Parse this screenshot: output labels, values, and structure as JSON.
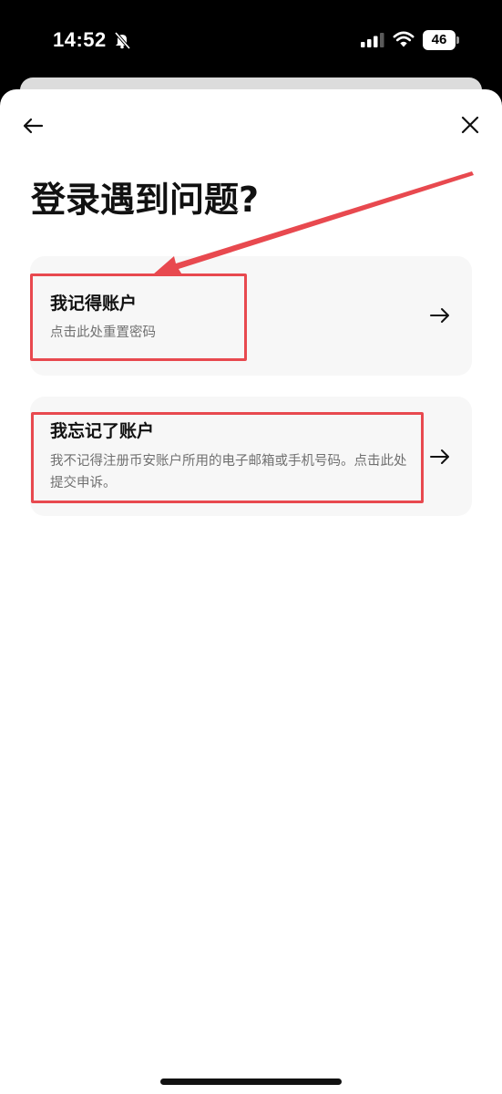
{
  "status_bar": {
    "time": "14:52",
    "battery": "46",
    "icons": [
      "bell-off-icon",
      "signal-icon",
      "wifi-icon",
      "battery-icon"
    ]
  },
  "nav": {
    "back_icon": "arrow-left-icon",
    "close_icon": "close-icon"
  },
  "page": {
    "title": "登录遇到问题?"
  },
  "options": [
    {
      "title": "我记得账户",
      "description": "点击此处重置密码",
      "icon": "arrow-right-icon"
    },
    {
      "title": "我忘记了账户",
      "description": "我不记得注册币安账户所用的电子邮箱或手机号码。点击此处提交申诉。",
      "icon": "arrow-right-icon"
    }
  ],
  "annotations": {
    "highlight_color": "#e8494f"
  }
}
